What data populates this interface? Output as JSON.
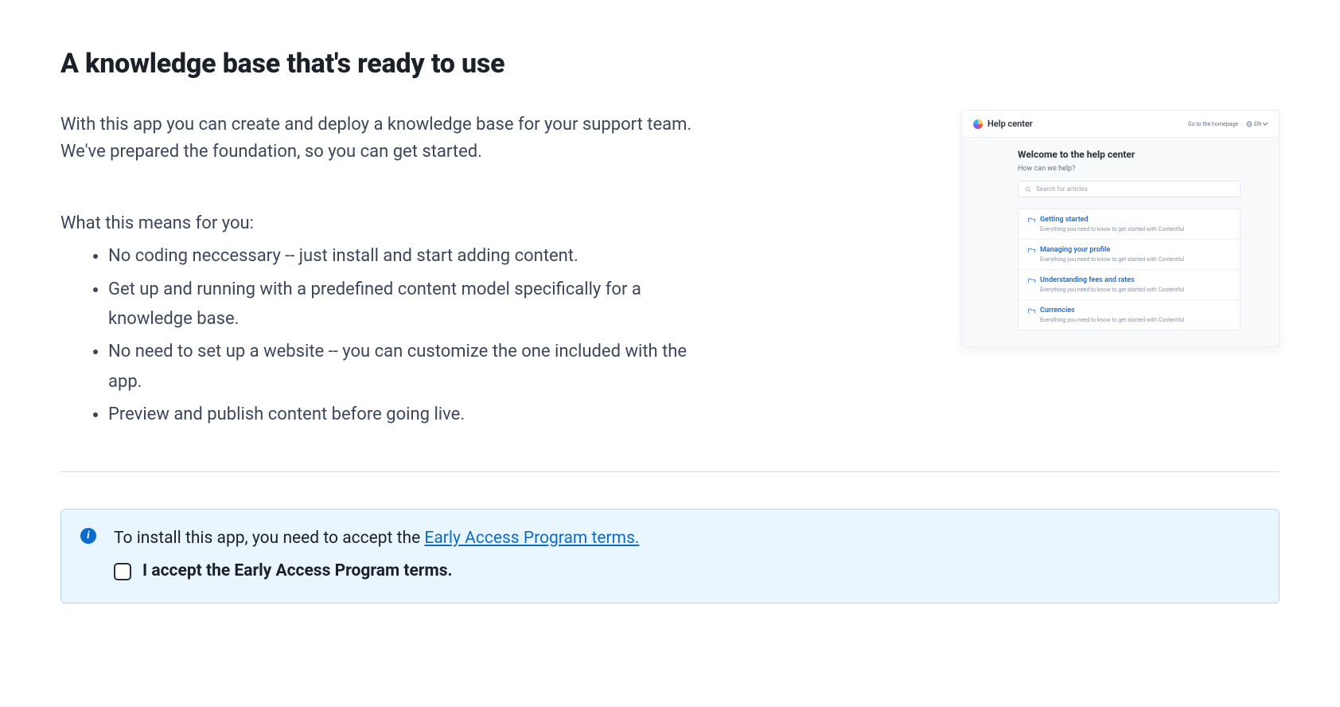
{
  "page": {
    "title": "A knowledge base that's ready to use",
    "intro": "With this app you can create and deploy a knowledge base for your support team. We've prepared the foundation, so you can get started.",
    "subhead": "What this means for you:",
    "benefits": [
      "No coding neccessary -- just install and start adding content.",
      "Get up and running with a predefined content model specifically for a knowledge base.",
      "No need to set up a website -- you can customize the one included with the app.",
      "Preview and publish content before going live."
    ]
  },
  "preview": {
    "brand": "Help center",
    "homepage_link": "Go to the homepage",
    "lang": "EN",
    "welcome": "Welcome to the help center",
    "help_q": "How can we help?",
    "search_placeholder": "Search for articles",
    "items": [
      {
        "title": "Getting started",
        "sub": "Everything you need to know to get started with Contentful"
      },
      {
        "title": "Managing your profile",
        "sub": "Everything you need to know to get started with Contentful"
      },
      {
        "title": "Understanding fees and rates",
        "sub": "Everything you need to know to get started with Contentful"
      },
      {
        "title": "Currencies",
        "sub": "Everything you need to know to get started with Contentful"
      }
    ]
  },
  "notice": {
    "prefix": "To install this app, you need to accept the ",
    "link_text": "Early Access Program terms.",
    "accept_label": "I accept the Early Access Program terms."
  }
}
